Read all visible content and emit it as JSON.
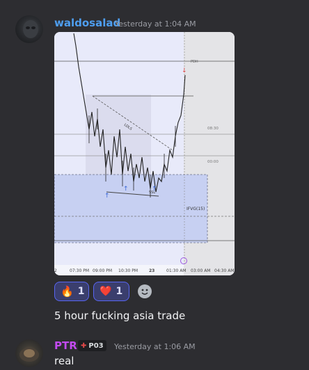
{
  "messages": [
    {
      "username": "waldosalad",
      "username_color": "#4e9ef0",
      "timestamp": "Yesterday at 1:04 AM",
      "text": "5 hour fucking asia trade",
      "attachment": {
        "kind": "chart-screenshot",
        "labels": {
          "pdh": "PDH",
          "ldls": "LDLS",
          "ssl": "SSL",
          "ifvg": "IFVG(15)",
          "level_0830": "08:30",
          "level_0000": "00:00",
          "day_marker": "23"
        },
        "x_ticks": [
          "2",
          "07:30 PM",
          "09:00 PM",
          "10:30 PM",
          "23",
          "01:30 AM",
          "03:00 AM",
          "04:30 AM"
        ]
      },
      "reactions": [
        {
          "emoji": "🔥",
          "icon": "fire-icon",
          "count": "1"
        },
        {
          "emoji": "❤️",
          "icon": "heart-icon",
          "count": "1"
        }
      ]
    },
    {
      "username": "PTR",
      "username_color": "#c34af1",
      "tag": "P03",
      "timestamp": "Yesterday at 1:06 AM",
      "text": "real"
    }
  ],
  "colors": {
    "background": "#2d2d31",
    "reaction_bg": "#3a3e6d",
    "reaction_border": "#5865f2"
  }
}
